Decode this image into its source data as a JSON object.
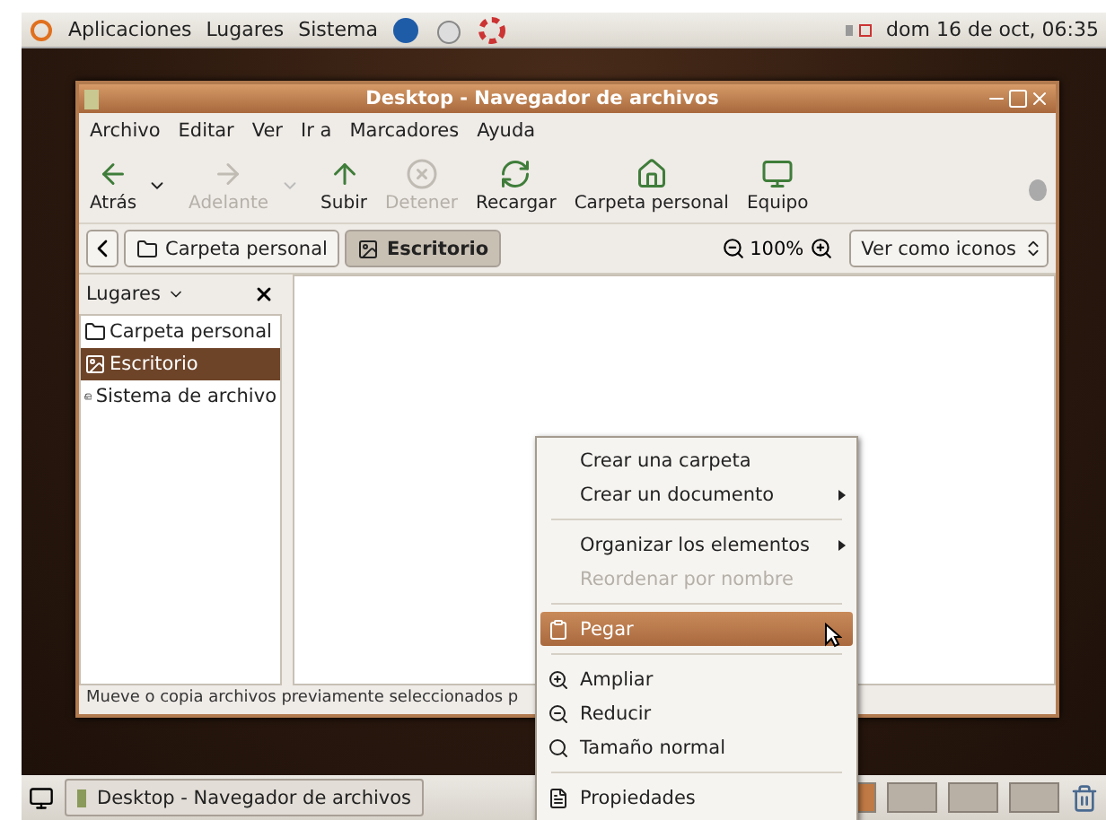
{
  "top_panel": {
    "menus": [
      "Aplicaciones",
      "Lugares",
      "Sistema"
    ],
    "clock": "dom 16 de oct, 06:35"
  },
  "window": {
    "title": "Desktop - Navegador de archivos",
    "menubar": [
      "Archivo",
      "Editar",
      "Ver",
      "Ir a",
      "Marcadores",
      "Ayuda"
    ],
    "toolbar": [
      {
        "label": "Atrás",
        "disabled": false,
        "dropdown": true
      },
      {
        "label": "Adelante",
        "disabled": true,
        "dropdown": true
      },
      {
        "label": "Subir",
        "disabled": false,
        "dropdown": false
      },
      {
        "label": "Detener",
        "disabled": true,
        "dropdown": false
      },
      {
        "label": "Recargar",
        "disabled": false,
        "dropdown": false
      },
      {
        "label": "Carpeta personal",
        "disabled": false,
        "dropdown": false
      },
      {
        "label": "Equipo",
        "disabled": false,
        "dropdown": false
      }
    ],
    "path": [
      {
        "label": "Carpeta personal",
        "selected": false
      },
      {
        "label": "Escritorio",
        "selected": true
      }
    ],
    "zoom": "100%",
    "view_mode": "Ver como iconos",
    "sidebar": {
      "title": "Lugares",
      "items": [
        {
          "label": "Carpeta personal",
          "selected": false
        },
        {
          "label": "Escritorio",
          "selected": true
        },
        {
          "label": "Sistema de archivo",
          "selected": false
        }
      ]
    },
    "status_bar": "Mueve o copia archivos previamente seleccionados p"
  },
  "context_menu": [
    {
      "kind": "item",
      "label": "Crear una carpeta",
      "disabled": false,
      "submenu": false,
      "selected": false
    },
    {
      "kind": "item",
      "label": "Crear un documento",
      "disabled": false,
      "submenu": true,
      "selected": false
    },
    {
      "kind": "separator"
    },
    {
      "kind": "item",
      "label": "Organizar los elementos",
      "disabled": false,
      "submenu": true,
      "selected": false
    },
    {
      "kind": "item",
      "label": "Reordenar por nombre",
      "disabled": true,
      "submenu": false,
      "selected": false
    },
    {
      "kind": "separator"
    },
    {
      "kind": "item",
      "label": "Pegar",
      "disabled": false,
      "submenu": false,
      "selected": true
    },
    {
      "kind": "separator"
    },
    {
      "kind": "item",
      "label": "Ampliar",
      "disabled": false,
      "submenu": false,
      "selected": false
    },
    {
      "kind": "item",
      "label": "Reducir",
      "disabled": false,
      "submenu": false,
      "selected": false
    },
    {
      "kind": "item",
      "label": "Tamaño normal",
      "disabled": false,
      "submenu": false,
      "selected": false
    },
    {
      "kind": "separator"
    },
    {
      "kind": "item",
      "label": "Propiedades",
      "disabled": false,
      "submenu": false,
      "selected": false
    }
  ],
  "bottom_panel": {
    "task": "Desktop - Navegador de archivos",
    "workspaces": [
      {
        "selected": true
      },
      {
        "selected": false
      },
      {
        "selected": false
      },
      {
        "selected": false
      }
    ]
  }
}
